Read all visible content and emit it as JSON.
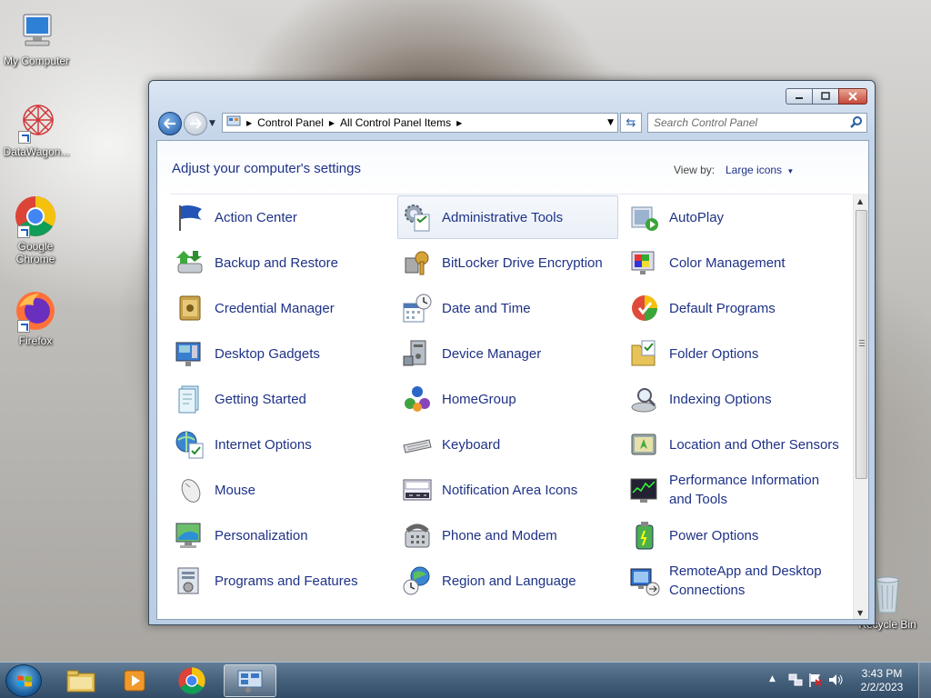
{
  "desktop": {
    "icons": [
      {
        "label": "My Computer"
      },
      {
        "label": "DataWagon..."
      },
      {
        "label": "Google Chrome"
      },
      {
        "label": "Firefox"
      },
      {
        "label": "Recycle Bin"
      }
    ]
  },
  "window": {
    "address": {
      "crumbs": [
        "Control Panel",
        "All Control Panel Items"
      ]
    },
    "search": {
      "placeholder": "Search Control Panel"
    },
    "header": {
      "title": "Adjust your computer's settings",
      "view_by_label": "View by:",
      "view_by_value": "Large icons"
    },
    "items": [
      {
        "label": "Action Center",
        "icon": "flag-icon"
      },
      {
        "label": "Administrative Tools",
        "icon": "admin-tools-icon"
      },
      {
        "label": "AutoPlay",
        "icon": "autoplay-icon"
      },
      {
        "label": "Backup and Restore",
        "icon": "backup-icon"
      },
      {
        "label": "BitLocker Drive Encryption",
        "icon": "bitlocker-icon"
      },
      {
        "label": "Color Management",
        "icon": "color-management-icon"
      },
      {
        "label": "Credential Manager",
        "icon": "credential-vault-icon"
      },
      {
        "label": "Date and Time",
        "icon": "clock-calendar-icon"
      },
      {
        "label": "Default Programs",
        "icon": "default-programs-icon"
      },
      {
        "label": "Desktop Gadgets",
        "icon": "gadgets-icon"
      },
      {
        "label": "Device Manager",
        "icon": "device-manager-icon"
      },
      {
        "label": "Folder Options",
        "icon": "folder-options-icon"
      },
      {
        "label": "Getting Started",
        "icon": "getting-started-icon"
      },
      {
        "label": "HomeGroup",
        "icon": "homegroup-icon"
      },
      {
        "label": "Indexing Options",
        "icon": "indexing-icon"
      },
      {
        "label": "Internet Options",
        "icon": "internet-options-icon"
      },
      {
        "label": "Keyboard",
        "icon": "keyboard-icon"
      },
      {
        "label": "Location and Other Sensors",
        "icon": "sensors-icon"
      },
      {
        "label": "Mouse",
        "icon": "mouse-icon"
      },
      {
        "label": "Notification Area Icons",
        "icon": "notification-icon"
      },
      {
        "label": "Performance Information and Tools",
        "icon": "performance-icon"
      },
      {
        "label": "Personalization",
        "icon": "personalization-icon"
      },
      {
        "label": "Phone and Modem",
        "icon": "phone-icon"
      },
      {
        "label": "Power Options",
        "icon": "power-icon"
      },
      {
        "label": "Programs and Features",
        "icon": "programs-icon"
      },
      {
        "label": "Region and Language",
        "icon": "region-icon"
      },
      {
        "label": "RemoteApp and Desktop Connections",
        "icon": "remoteapp-icon"
      }
    ]
  },
  "taskbar": {
    "clock_time": "3:43 PM",
    "clock_date": "2/2/2023"
  },
  "colors": {
    "link_blue": "#1e3287",
    "taskbar": "#3c5a78"
  }
}
